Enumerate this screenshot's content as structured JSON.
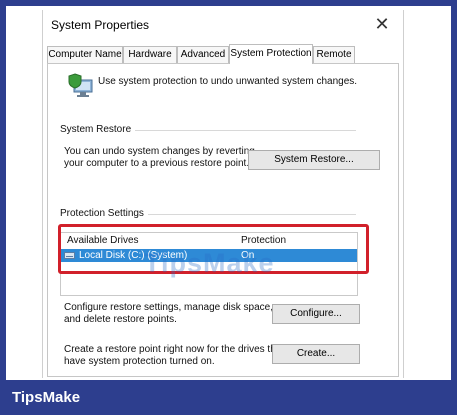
{
  "window": {
    "title": "System Properties",
    "close_glyph": "✕"
  },
  "tabs": [
    {
      "label": "Computer Name"
    },
    {
      "label": "Hardware"
    },
    {
      "label": "Advanced"
    },
    {
      "label": "System Protection",
      "active": true
    },
    {
      "label": "Remote"
    }
  ],
  "intro_text": "Use system protection to undo unwanted system changes.",
  "system_restore": {
    "group_label": "System Restore",
    "description_line1": "You can undo system changes by reverting",
    "description_line2": "your computer to a previous restore point.",
    "button_label": "System Restore..."
  },
  "protection": {
    "group_label": "Protection Settings",
    "columns": [
      "Available Drives",
      "Protection"
    ],
    "drives": [
      {
        "name": "Local Disk (C:) (System)",
        "protection": "On",
        "selected": true
      }
    ]
  },
  "configure": {
    "text_line1": "Configure restore settings, manage disk space,",
    "text_line2": "and delete restore points.",
    "button_label": "Configure..."
  },
  "create": {
    "text_line1": "Create a restore point right now for the drives that",
    "text_line2": "have system protection turned on.",
    "button_label": "Create..."
  },
  "watermark_text": "TipsMake",
  "brand_text": "TipsMake",
  "colors": {
    "background": "#2d3e8e",
    "selection": "#2e8ad6",
    "highlight_box": "#d1202a"
  },
  "icons": {
    "window": "shield-computer-icon",
    "drive": "disk-drive-icon",
    "close": "close-icon"
  }
}
